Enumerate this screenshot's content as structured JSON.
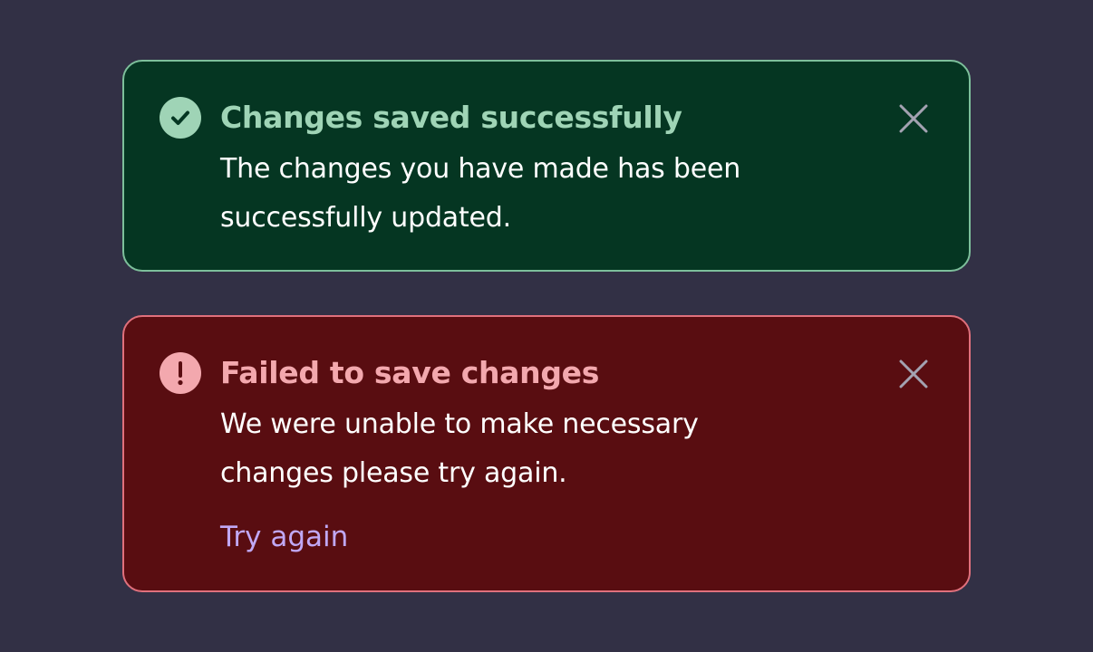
{
  "success_alert": {
    "icon": "check-circle-icon",
    "title": "Changes saved successfully",
    "message": "The changes you have made has been successfully updated.",
    "close_icon": "close-icon",
    "colors": {
      "background": "#053622",
      "border": "#7dbf9b",
      "accent": "#9fd4b6"
    }
  },
  "error_alert": {
    "icon": "exclamation-circle-icon",
    "title": "Failed to save changes",
    "message": "We were unable to make necessary changes please try again.",
    "action_label": "Try again",
    "close_icon": "close-icon",
    "colors": {
      "background": "#590d11",
      "border": "#e0707c",
      "accent": "#f3a8ae",
      "link": "#c1a8f5"
    }
  },
  "page": {
    "background": "#323045"
  }
}
